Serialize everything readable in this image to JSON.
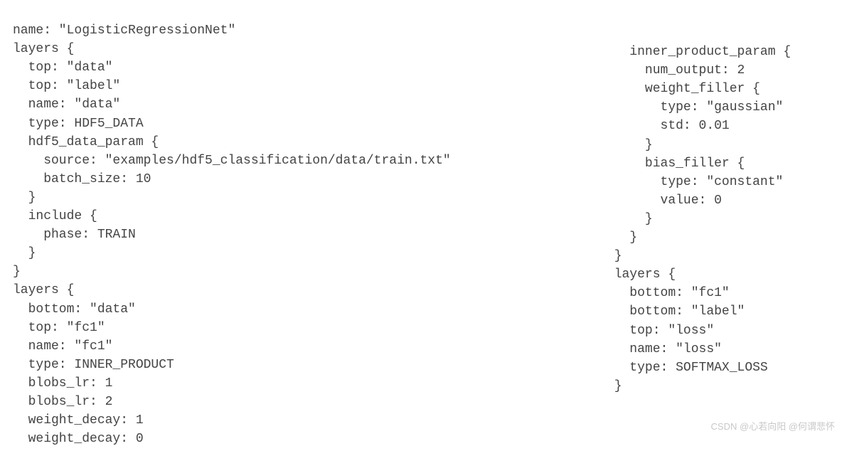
{
  "left": {
    "l01": "name: \"LogisticRegressionNet\"",
    "l02": "layers {",
    "l03": "  top: \"data\"",
    "l04": "  top: \"label\"",
    "l05": "  name: \"data\"",
    "l06": "  type: HDF5_DATA",
    "l07": "  hdf5_data_param {",
    "l08": "    source: \"examples/hdf5_classification/data/train.txt\"",
    "l09": "    batch_size: 10",
    "l10": "  }",
    "l11": "  include {",
    "l12": "    phase: TRAIN",
    "l13": "  }",
    "l14": "}",
    "l15": "layers {",
    "l16": "  bottom: \"data\"",
    "l17": "  top: \"fc1\"",
    "l18": "  name: \"fc1\"",
    "l19": "  type: INNER_PRODUCT",
    "l20": "  blobs_lr: 1",
    "l21": "  blobs_lr: 2",
    "l22": "  weight_decay: 1",
    "l23": "  weight_decay: 0"
  },
  "right": {
    "r01": "  inner_product_param {",
    "r02": "    num_output: 2",
    "r03": "    weight_filler {",
    "r04": "      type: \"gaussian\"",
    "r05": "      std: 0.01",
    "r06": "    }",
    "r07": "    bias_filler {",
    "r08": "      type: \"constant\"",
    "r09": "      value: 0",
    "r10": "    }",
    "r11": "  }",
    "r12": "}",
    "r13": "layers {",
    "r14": "  bottom: \"fc1\"",
    "r15": "  bottom: \"label\"",
    "r16": "  top: \"loss\"",
    "r17": "  name: \"loss\"",
    "r18": "  type: SOFTMAX_LOSS",
    "r19": "}"
  },
  "watermark": "CSDN @心若向阳 @何谓悲怀"
}
